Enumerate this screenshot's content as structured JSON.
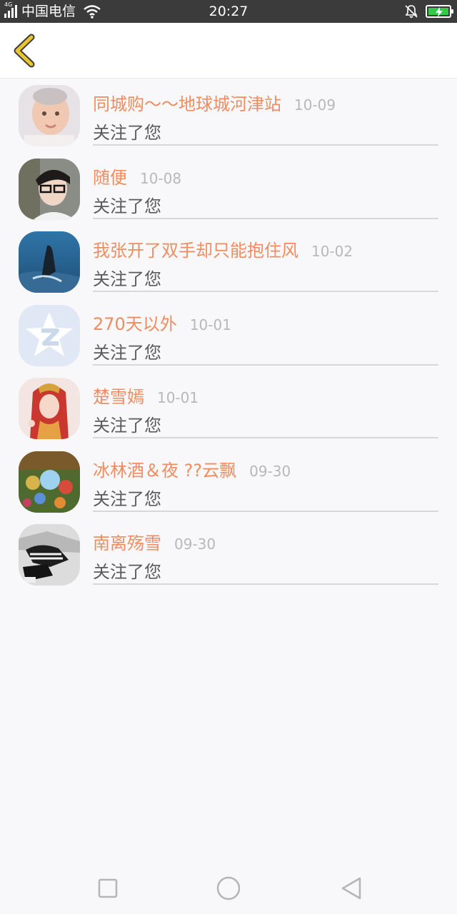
{
  "status_bar": {
    "network_tag": "4G",
    "carrier": "中国电信",
    "time": "20:27",
    "icons": [
      "signal-icon",
      "wifi-icon",
      "bell-muted-icon",
      "battery-charging-icon"
    ],
    "battery_color": "#35c94a"
  },
  "header": {
    "back_icon": "chevron-left-icon",
    "back_icon_color": "#e8c531"
  },
  "followers": [
    {
      "name": "同城购～～地球城河津站",
      "date": "10-09",
      "message": "关注了您"
    },
    {
      "name": "随便",
      "date": "10-08",
      "message": "关注了您"
    },
    {
      "name": "我张开了双手却只能抱住风",
      "date": "10-02",
      "message": "关注了您"
    },
    {
      "name": "270天以外",
      "date": "10-01",
      "message": "关注了您"
    },
    {
      "name": "楚雪嫣",
      "date": "10-01",
      "message": "关注了您"
    },
    {
      "name": "冰林酒＆夜 ??云飘",
      "date": "09-30",
      "message": "关注了您"
    },
    {
      "name": "南离殇雪",
      "date": "09-30",
      "message": "关注了您"
    }
  ],
  "colors": {
    "name": "#ef8d60",
    "date": "#b8b8b8",
    "message": "#5a5a5a",
    "background": "#f8f7f9"
  },
  "nav_bar": {
    "buttons": [
      "recent-apps-icon",
      "home-icon",
      "back-triangle-icon"
    ]
  }
}
